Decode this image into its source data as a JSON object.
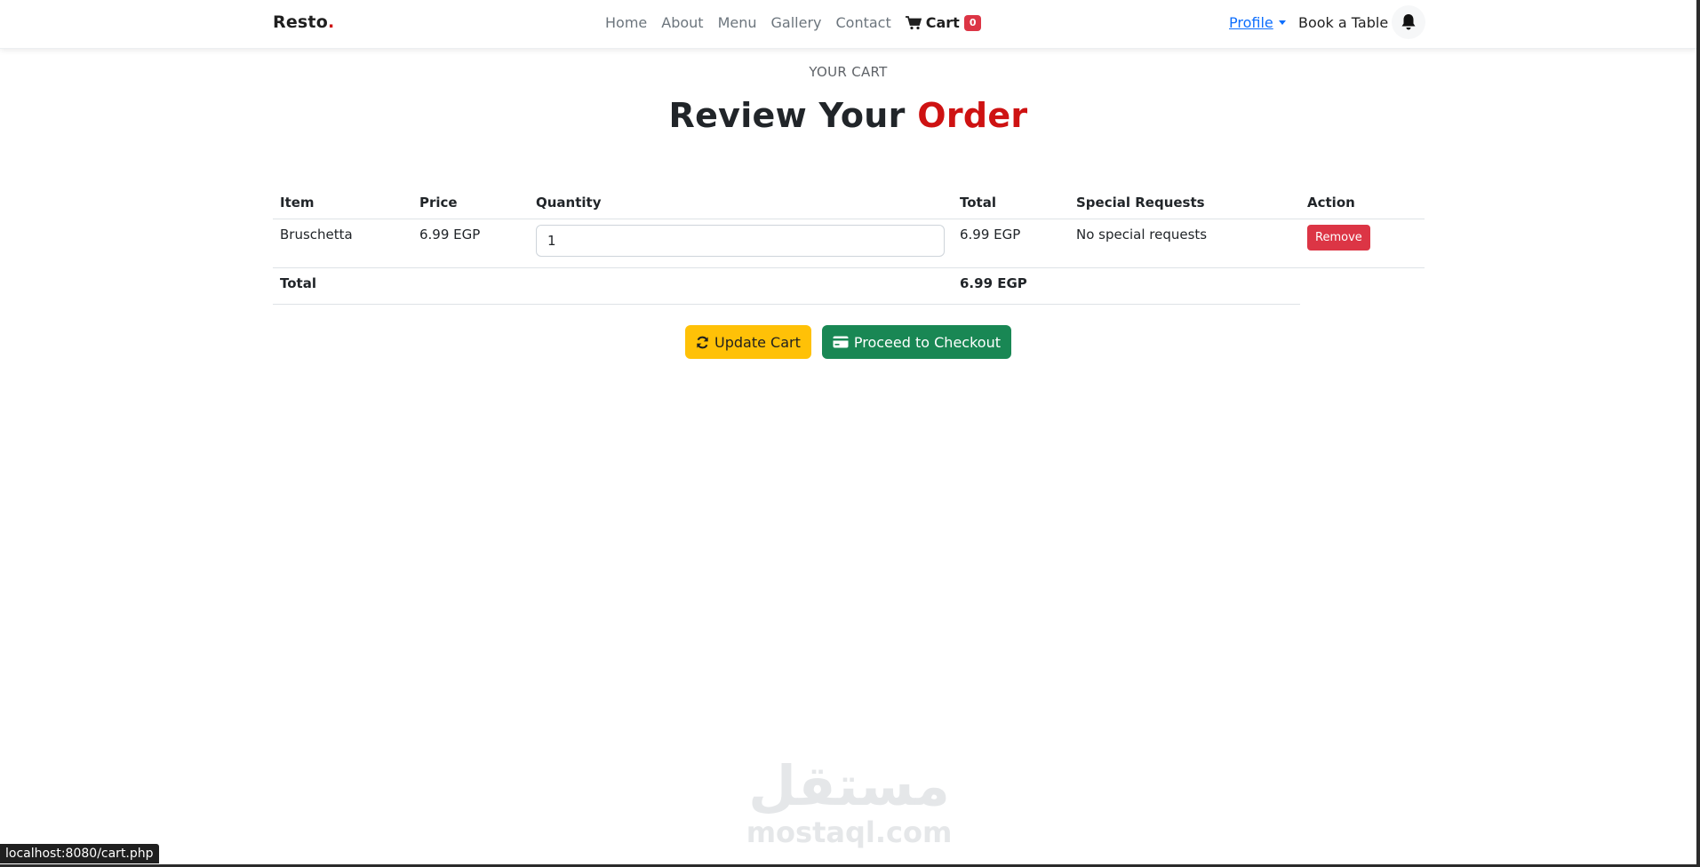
{
  "brand": {
    "name": "Resto",
    "dot": "."
  },
  "nav": {
    "links": [
      "Home",
      "About",
      "Menu",
      "Gallery",
      "Contact"
    ],
    "cart_label": "Cart",
    "cart_count": "0",
    "profile_label": "Profile",
    "book_label": "Book a Table"
  },
  "header": {
    "subtitle": "YOUR CART",
    "title_main": "Review Your",
    "title_accent": "Order"
  },
  "table": {
    "headers": [
      "Item",
      "Price",
      "Quantity",
      "Total",
      "Special Requests",
      "Action"
    ],
    "rows": [
      {
        "item": "Bruschetta",
        "price": "6.99 EGP",
        "quantity": "1",
        "total": "6.99 EGP",
        "special": "No special requests",
        "action": "Remove"
      }
    ],
    "total_label": "Total",
    "total_value": "6.99 EGP"
  },
  "actions": {
    "update_label": "Update Cart",
    "checkout_label": "Proceed to Checkout"
  },
  "watermark": {
    "arabic": "مستقل",
    "latin": "mostaql.com"
  },
  "status_url": "localhost:8080/cart.php",
  "colors": {
    "accent": "#ce1212",
    "link": "#0d6efd",
    "danger": "#dc3545",
    "warning": "#ffc107",
    "success": "#198754"
  }
}
